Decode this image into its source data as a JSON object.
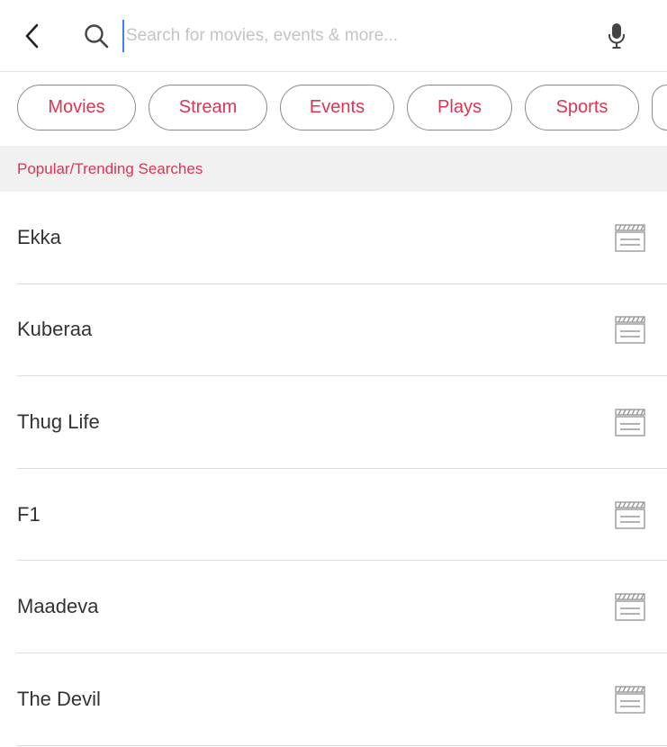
{
  "search": {
    "placeholder": "Search for movies, events & more..."
  },
  "icons": {
    "back": "chevron-left-icon",
    "search": "magnifier-icon",
    "mic": "microphone-icon",
    "item": "clapperboard-icon"
  },
  "colors": {
    "accent": "#dc3553",
    "text": "#333333",
    "header_bg": "#f1f1f1"
  },
  "chips": [
    {
      "label": "Movies"
    },
    {
      "label": "Stream"
    },
    {
      "label": "Events"
    },
    {
      "label": "Plays"
    },
    {
      "label": "Sports"
    },
    {
      "label": ""
    }
  ],
  "section": {
    "title": "Popular/Trending Searches"
  },
  "items": [
    {
      "label": "Ekka"
    },
    {
      "label": "Kuberaa"
    },
    {
      "label": "Thug Life"
    },
    {
      "label": "F1"
    },
    {
      "label": "Maadeva"
    },
    {
      "label": "The Devil"
    }
  ]
}
